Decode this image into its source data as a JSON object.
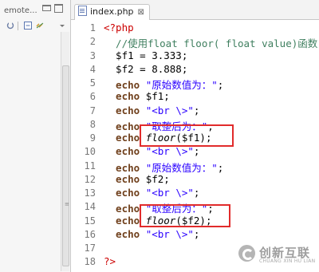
{
  "left_panel": {
    "tab_label": "emote..."
  },
  "editor": {
    "tab_label": "index.php",
    "tab_close": "⊠",
    "lines": [
      {
        "num": "1",
        "segs": [
          {
            "c": "tag",
            "t": "<?php"
          }
        ]
      },
      {
        "num": "2",
        "segs": [
          {
            "c": "cmt",
            "t": "  //使用float floor( float value)函数"
          }
        ]
      },
      {
        "num": "3",
        "segs": [
          {
            "c": "var",
            "t": "  $f1 = 3.333;"
          }
        ]
      },
      {
        "num": "4",
        "segs": [
          {
            "c": "var",
            "t": "  $f2 = 8.888;"
          }
        ]
      },
      {
        "num": "5",
        "segs": [
          {
            "c": "kw",
            "t": "  echo "
          },
          {
            "c": "str",
            "t": "\"原始数值为：\""
          },
          {
            "c": "var",
            "t": ";"
          }
        ]
      },
      {
        "num": "6",
        "segs": [
          {
            "c": "kw",
            "t": "  echo "
          },
          {
            "c": "var",
            "t": "$f1;"
          }
        ]
      },
      {
        "num": "7",
        "segs": [
          {
            "c": "kw",
            "t": "  echo "
          },
          {
            "c": "str",
            "t": "\"<br \\>\""
          },
          {
            "c": "var",
            "t": ";"
          }
        ]
      },
      {
        "num": "8",
        "segs": [
          {
            "c": "kw",
            "t": "  echo "
          },
          {
            "c": "str",
            "t": "\"取整后为：\""
          },
          {
            "c": "var",
            "t": ";"
          }
        ]
      },
      {
        "num": "9",
        "segs": [
          {
            "c": "kw",
            "t": "  echo "
          },
          {
            "c": "fn",
            "t": "floor"
          },
          {
            "c": "var",
            "t": "($f1);"
          }
        ]
      },
      {
        "num": "10",
        "segs": [
          {
            "c": "kw",
            "t": "  echo "
          },
          {
            "c": "str",
            "t": "\"<br \\>\""
          },
          {
            "c": "var",
            "t": ";"
          }
        ]
      },
      {
        "num": "11",
        "segs": [
          {
            "c": "kw",
            "t": "  echo "
          },
          {
            "c": "str",
            "t": "\"原始数值为：\""
          },
          {
            "c": "var",
            "t": ";"
          }
        ]
      },
      {
        "num": "12",
        "segs": [
          {
            "c": "kw",
            "t": "  echo "
          },
          {
            "c": "var",
            "t": "$f2;"
          }
        ]
      },
      {
        "num": "13",
        "segs": [
          {
            "c": "kw",
            "t": "  echo "
          },
          {
            "c": "str",
            "t": "\"<br \\>\""
          },
          {
            "c": "var",
            "t": ";"
          }
        ]
      },
      {
        "num": "14",
        "segs": [
          {
            "c": "kw",
            "t": "  echo "
          },
          {
            "c": "str",
            "t": "\"取整后为：\""
          },
          {
            "c": "var",
            "t": ";"
          }
        ]
      },
      {
        "num": "15",
        "segs": [
          {
            "c": "kw",
            "t": "  echo "
          },
          {
            "c": "fn",
            "t": "floor"
          },
          {
            "c": "var",
            "t": "($f2);"
          }
        ]
      },
      {
        "num": "16",
        "segs": [
          {
            "c": "kw",
            "t": "  echo "
          },
          {
            "c": "str",
            "t": "\"<br \\>\""
          },
          {
            "c": "var",
            "t": ";"
          }
        ]
      },
      {
        "num": "17",
        "segs": []
      },
      {
        "num": "18",
        "segs": [
          {
            "c": "tag",
            "t": "?>"
          }
        ]
      }
    ]
  },
  "watermark": {
    "title": "创新互联",
    "subtitle": "CHUANG XIN HU LIAN"
  },
  "colors": {
    "highlight_box": "#e12b2b",
    "php_tag": "#cc0000",
    "comment": "#3f7f5f",
    "keyword": "#6f3f1b",
    "string": "#2a00ff"
  },
  "icons": [
    "minimize-icon",
    "maximize-icon",
    "sync-icon",
    "collapse-all-icon",
    "link-editor-icon",
    "view-menu-icon",
    "php-file-icon",
    "close-icon",
    "watermark-logo-icon"
  ]
}
